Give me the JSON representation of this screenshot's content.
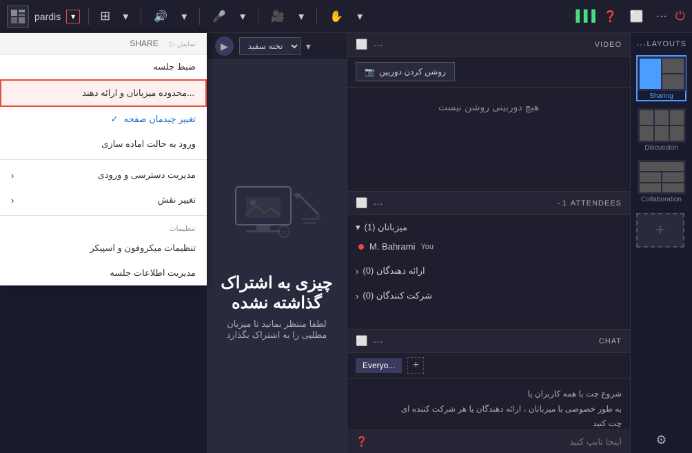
{
  "app": {
    "logo_text": "🎬",
    "name": "pardis",
    "title_label": "pardis"
  },
  "topbar": {
    "grid_icon": "⊞",
    "chevron_icon": "▾",
    "audio_icon": "🔊",
    "mic_icon": "🎤",
    "video_icon": "🎥",
    "hand_icon": "✋",
    "spacer": "",
    "signal_icon": "▐▐▐",
    "help_icon": "?",
    "screen_icon": "⬜",
    "more_icon": "···",
    "close_icon": "⏻"
  },
  "share": {
    "header_label": "SHARE",
    "menu": [
      {
        "id": "adjust-session",
        "label": "ضبط جلسه",
        "type": "normal"
      },
      {
        "id": "host-limit",
        "label": "محدوده میزبانان و ارائه دهند...",
        "type": "highlighted"
      },
      {
        "id": "change-layout",
        "label": "تغییر چیدمان صفحه",
        "type": "blue-check"
      },
      {
        "id": "ready-mode",
        "label": "ورود به حالت اماده سازی",
        "type": "normal"
      },
      {
        "id": "access-mgmt",
        "label": "مدیریت دسترسی و ورودی",
        "type": "arrow"
      },
      {
        "id": "change-role",
        "label": "تغییر نقش",
        "type": "arrow"
      },
      {
        "id": "settings-label",
        "label": "تنظیمات",
        "type": "section"
      },
      {
        "id": "mic-settings",
        "label": "تنظیمات میکروفون و اسپیکر",
        "type": "normal"
      },
      {
        "id": "session-info",
        "label": "مدیریت اطلاعات جلسه",
        "type": "normal"
      }
    ],
    "present_btn": "▶",
    "whiteboard_label": "تخته سفید",
    "main_text": "چیزی به اشتراک گذاشته نشده",
    "sub_text": "لطفا منتظر بمانید تا میزبان مطلبی را به اشتراک بگذارد"
  },
  "video": {
    "section_title": "VIDEO",
    "camera_btn_label": "روشن کردن دوربین",
    "no_camera_text": "هیچ دوربینی روشن نیست"
  },
  "attendees": {
    "section_title": "ATTENDEES",
    "count": "- 1",
    "hosts_label": "میزبانان (1)",
    "presenters_label": "ارائه دهندگان (0)",
    "participants_label": "شرکت کنندگان (0)",
    "attendee_name": "M. Bahrami",
    "you_label": "You"
  },
  "chat": {
    "section_title": "CHAT",
    "tab_everyone": "Everyo...",
    "chat_info_line1": "شروع چت با همه کاربران یا",
    "chat_info_line2": "به طور خصوصی با میزبانان ، ارائه دهندگان یا هر شرکت کننده ای",
    "chat_info_line3": "چت کنید",
    "input_placeholder": "اینجا تایپ کنید"
  },
  "layouts": {
    "title": "LAYOUTS",
    "items": [
      {
        "id": "sharing",
        "label": "Sharing",
        "active": true
      },
      {
        "id": "discussion",
        "label": "Discussion",
        "active": false
      },
      {
        "id": "collaboration",
        "label": "Collaboration",
        "active": false
      }
    ],
    "add_label": "+"
  },
  "icons": {
    "more": "···",
    "minimize": "⬜",
    "expand": "⬜",
    "chevron_down": "▾",
    "chevron_right": "›",
    "check": "✓",
    "plus": "+",
    "help": "?",
    "settings": "⚙"
  }
}
